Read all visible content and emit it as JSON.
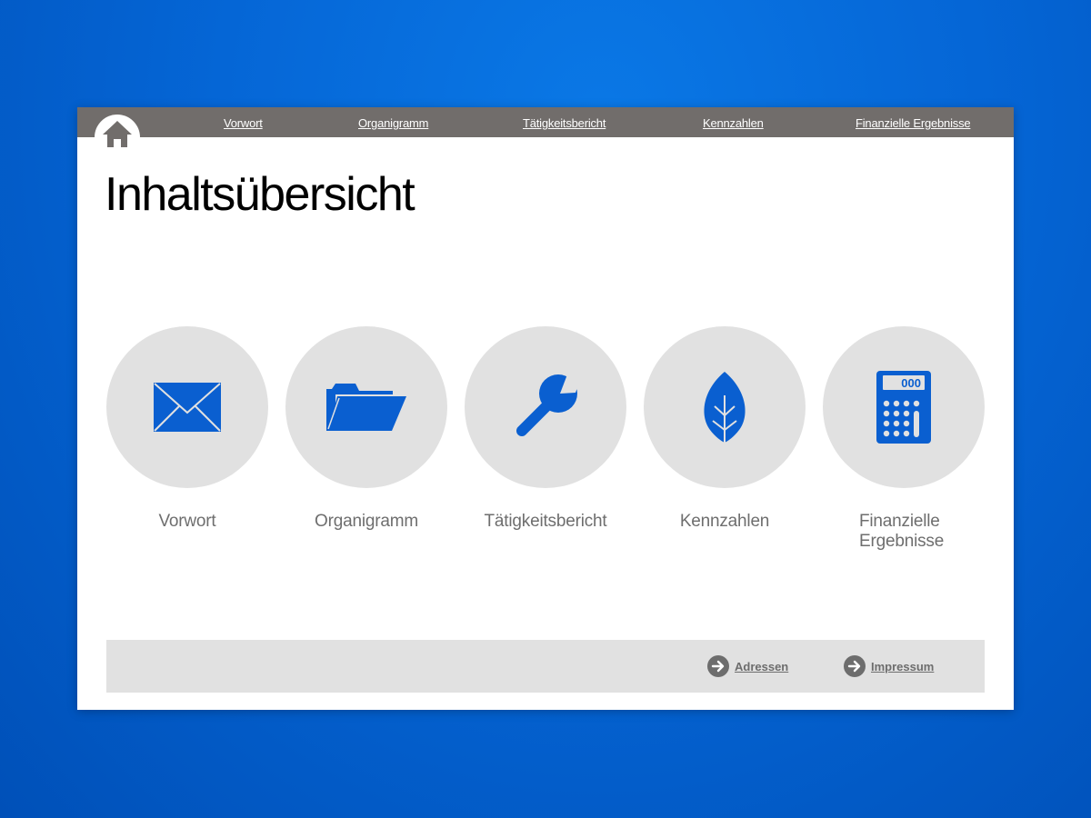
{
  "nav": {
    "home_icon": "home-icon",
    "links": [
      {
        "label": "Vorwort"
      },
      {
        "label": "Organigramm"
      },
      {
        "label": "Tätigkeitsbericht"
      },
      {
        "label": "Kennzahlen"
      },
      {
        "label": "Finanzielle Ergebnisse"
      }
    ]
  },
  "title": "Inhaltsübersicht",
  "tiles": [
    {
      "label": "Vorwort",
      "icon": "envelope-icon"
    },
    {
      "label": "Organigramm",
      "icon": "folder-icon"
    },
    {
      "label": "Tätigkeitsbericht",
      "icon": "wrench-icon"
    },
    {
      "label": "Kennzahlen",
      "icon": "leaf-icon"
    },
    {
      "label": "Finanzielle Ergebnisse",
      "icon": "calculator-icon",
      "calculator_display": "000"
    }
  ],
  "footer": {
    "links": [
      {
        "label": "Adressen",
        "icon": "arrow-right-icon"
      },
      {
        "label": "Impressum",
        "icon": "arrow-right-icon"
      }
    ]
  },
  "colors": {
    "background": "#0566d6",
    "topbar": "#716d6b",
    "icon_blue": "#0a5fd0",
    "tile_circle": "#e1e1e1",
    "label_gray": "#6e6e6e"
  }
}
